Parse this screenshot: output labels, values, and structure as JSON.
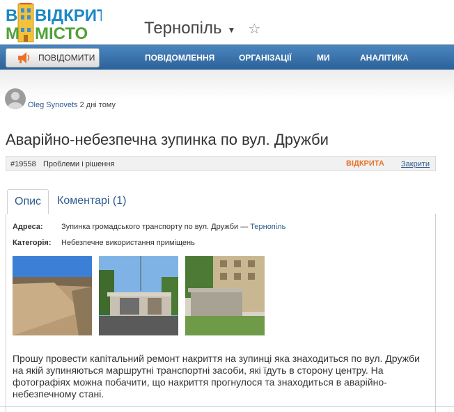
{
  "logo": {
    "line1": "ВІДКРИТЕ",
    "line2": "МІСТО"
  },
  "city": {
    "name": "Тернопіль"
  },
  "nav": {
    "report_label": "ПОВІДОМИТИ",
    "items": [
      "ПОВІДОМЛЕННЯ",
      "ОРГАНІЗАЦІЇ",
      "МИ",
      "АНАЛІТИКА"
    ]
  },
  "author": {
    "name": "Oleg Synovets",
    "time": "2 дні тому"
  },
  "issue": {
    "title": "Аварійно-небезпечна зупинка по вул. Дружби",
    "number": "#19558",
    "category_path": "Проблеми і рішення",
    "status": "ВІДКРИТА",
    "close_label": "Закрити"
  },
  "tabs": [
    {
      "label": "Опис"
    },
    {
      "label": "Коментарі (1)"
    }
  ],
  "details": {
    "address_label": "Адреса:",
    "address_value": "Зупинка громадського транспорту по вул. Дружби —",
    "address_city": "Тернопіль",
    "category_label": "Категорія:",
    "category_value": "Небезпечне використання приміщень"
  },
  "description": "Прошу провести капітальний ремонт накриття на зупинці яка знаходиться по вул. Дружби на якій зупиняються маршрутні транспортні засоби, які їдуть в сторону центру. На фотографіях можна побачити, що накриття прогнулося та знаходиться в аварійно-небезпечному стані.",
  "colors": {
    "nav_bar": "#3b74ad",
    "link": "#2b5a8e",
    "status": "#e8732b",
    "logo_blue": "#1c88c7",
    "logo_green": "#52a13a"
  }
}
